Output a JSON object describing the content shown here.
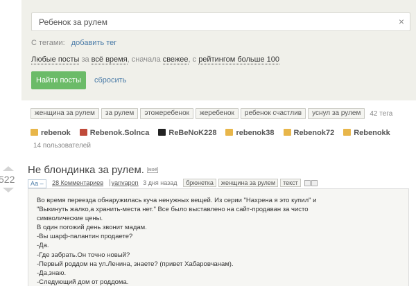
{
  "search": {
    "value": "Ребенок за рулем",
    "clear_icon": "×"
  },
  "filters": {
    "tags_label": "С тегами:",
    "add_tag": "добавить тег",
    "sort": {
      "any": "Любые посты",
      "za": "за",
      "period": "всё время",
      "first": ", сначала",
      "order": "свежее",
      "with": ", с",
      "rating": "рейтингом больше 100"
    },
    "find_button": "Найти посты",
    "reset": "сбросить"
  },
  "tag_cloud": {
    "tags": [
      "женщина за рулем",
      "за рулем",
      "этожеребенок",
      "жеребенок",
      "ребенок счастлив",
      "уснул за рулем"
    ],
    "count": "42 тега"
  },
  "users": {
    "list": [
      {
        "name": "rebenok",
        "color": "#e8b64a"
      },
      {
        "name": "Rebenok.Solnca",
        "color": "#c04a3a"
      },
      {
        "name": "ReBeNoK228",
        "color": "#222222"
      },
      {
        "name": "rebenok38",
        "color": "#e8b64a"
      },
      {
        "name": "Rebenok72",
        "color": "#e8b64a"
      },
      {
        "name": "Rebenokk",
        "color": "#e8b64a"
      }
    ],
    "count": "14 пользователей"
  },
  "post": {
    "rating": "522",
    "title": "Не блондинка за рулем.",
    "badge": "[моё]",
    "font_toggle": "Аа –",
    "comments": "28 Комментариев",
    "author": "yanvapon",
    "time": "3 дня назад",
    "tags": [
      "брюнетка",
      "женщина за рулем",
      "текст"
    ],
    "body": [
      "Во время переезда обнаружилась куча ненужных вещей. Из серии \"Нахрена я это купил\" и",
      "\"Выкинуть жалко,а хранить-места нет.\" Все было выставлено на сайт-продаван за чисто",
      "символические цены.",
      "В один погожий день звонит мадам.",
      "-Вы шарф-палантин продаете?",
      "-Да.",
      "-Где забрать.Он точно новый?",
      "-Первый роддом на ул.Ленина, знаете? (привет Хабаровчанам).",
      "-Да,знаю.",
      "-Следующий дом от роддома."
    ]
  },
  "colors": {
    "accent_green": "#6bbb68",
    "link_blue": "#4a7ba7",
    "panel_bg": "#f0f0ea"
  }
}
